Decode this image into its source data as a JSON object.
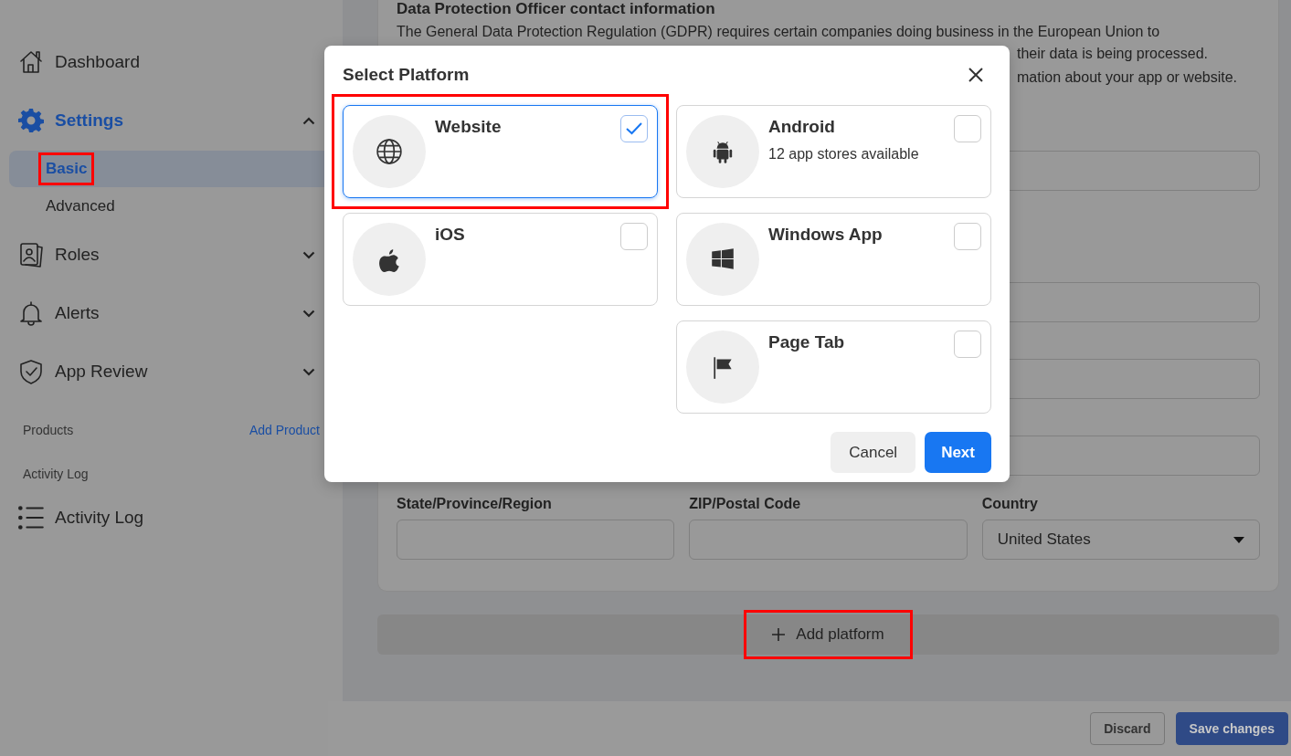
{
  "sidebar": {
    "items": [
      {
        "kind": "item",
        "label": "Dashboard",
        "active": false
      },
      {
        "kind": "group",
        "label": "Settings",
        "active": true,
        "expanded": true,
        "children": [
          {
            "label": "Basic",
            "selected": true,
            "highlighted": true
          },
          {
            "label": "Advanced",
            "selected": false,
            "highlighted": false
          }
        ]
      },
      {
        "kind": "group",
        "label": "Roles",
        "active": false,
        "expanded": false
      },
      {
        "kind": "group",
        "label": "Alerts",
        "active": false,
        "expanded": false
      },
      {
        "kind": "group",
        "label": "App Review",
        "active": false,
        "expanded": false
      },
      {
        "kind": "section",
        "label": "Products",
        "link": "Add Product"
      },
      {
        "kind": "section",
        "label": "Activity Log"
      },
      {
        "kind": "item",
        "label": "Activity Log",
        "active": false
      }
    ]
  },
  "background": {
    "heading": "Data Protection Officer contact information",
    "paragraph_line": "The General Data Protection Regulation (GDPR) requires certain companies doing business in the European Union to",
    "paragraph_fragments": [
      "their data is being processed.",
      "mation about your app or website."
    ],
    "address_fields": [
      {
        "kind": "text",
        "label": "State/Province/Region"
      },
      {
        "kind": "text",
        "label": "ZIP/Postal Code"
      },
      {
        "kind": "select",
        "label": "Country",
        "value": "United States"
      }
    ],
    "add_platform": {
      "label": "Add platform",
      "highlighted": true
    },
    "footer": {
      "buttons": [
        {
          "kind": "secondary",
          "label": "Discard"
        },
        {
          "kind": "primary",
          "label": "Save changes"
        }
      ]
    }
  },
  "modal": {
    "title": "Select Platform",
    "platform_columns": [
      [
        {
          "title": "Website",
          "checked": true,
          "highlighted": true
        },
        {
          "title": "iOS",
          "checked": false
        }
      ],
      [
        {
          "title": "Android",
          "subtitle": "12 app stores available",
          "checked": false
        },
        {
          "title": "Windows App",
          "checked": false
        },
        {
          "title": "Page Tab",
          "checked": false
        }
      ]
    ],
    "buttons": [
      {
        "kind": "secondary",
        "label": "Cancel"
      },
      {
        "kind": "primary",
        "label": "Next"
      }
    ]
  }
}
